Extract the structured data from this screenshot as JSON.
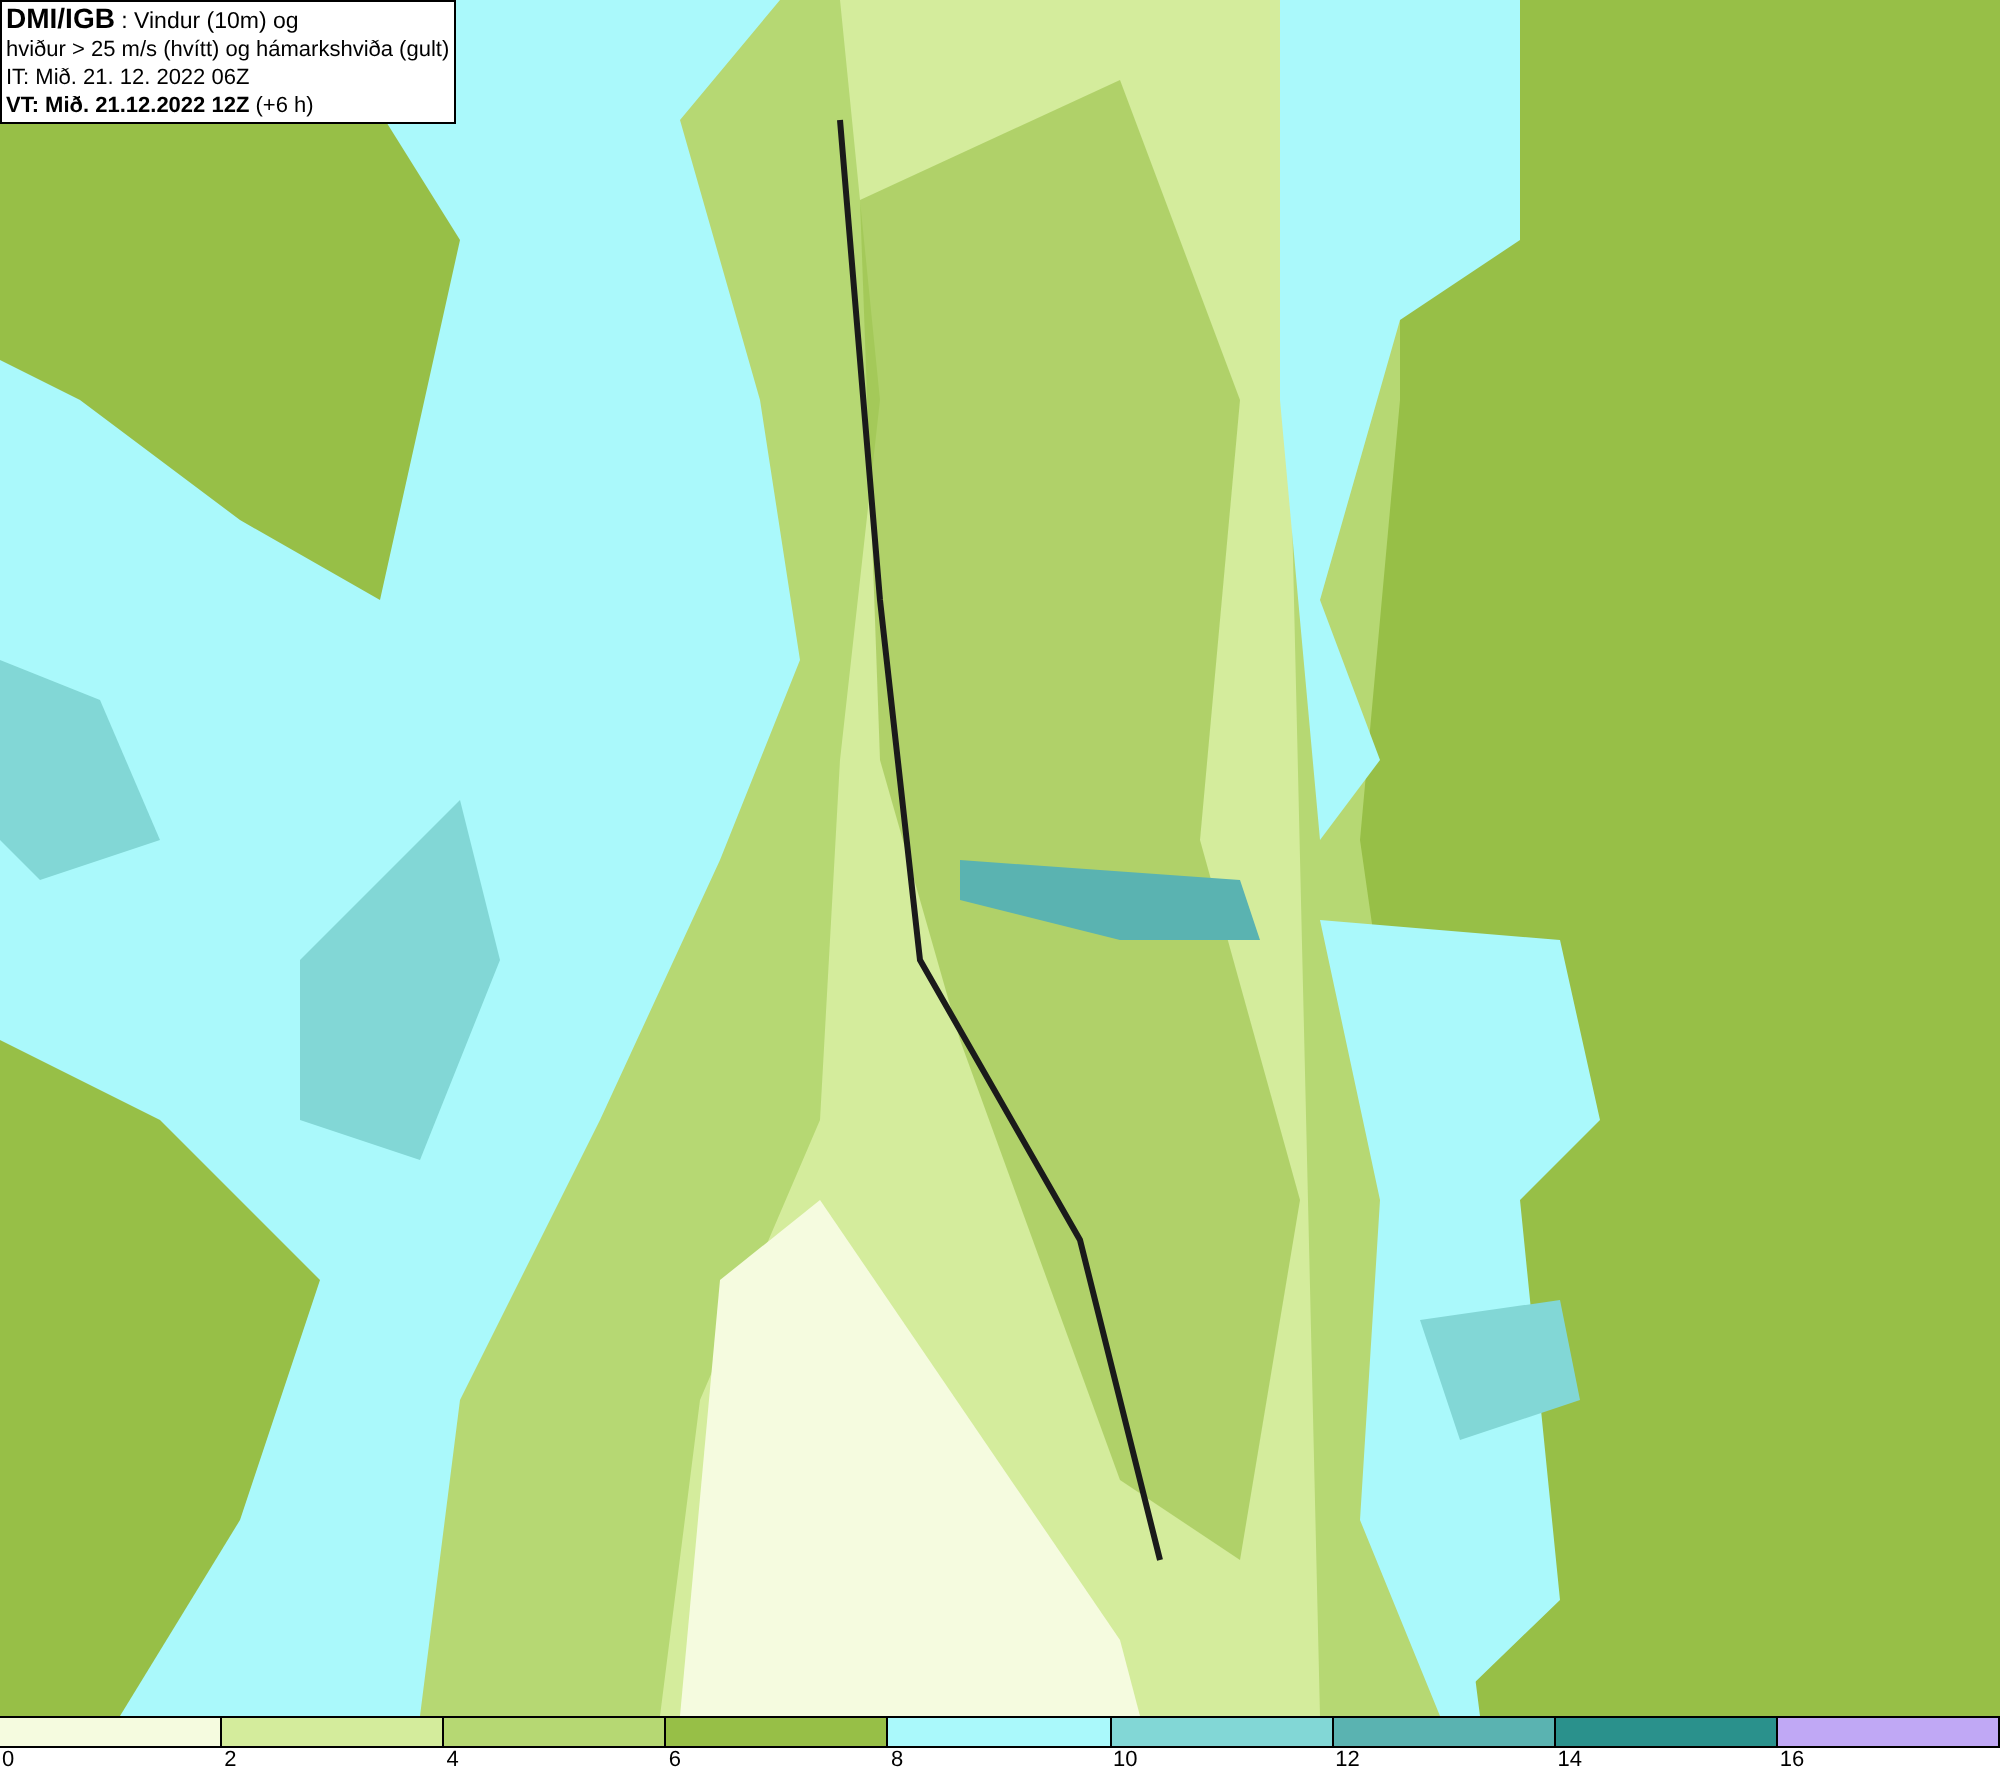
{
  "info_box": {
    "lines": [
      "**DMI/IGB** : Vindur (10m) og",
      "hviður > 25 m/s (hvítt) og hámarkshviða (gult)",
      "IT: Mið. 21. 12. 2022 06Z",
      "**VT: Mið. 21.12.2022 12Z** (+6 h)"
    ]
  },
  "legend": {
    "segments": [
      {
        "color": "#f5fbdf"
      },
      {
        "color": "#d4ec9c"
      },
      {
        "color": "#b6d873"
      },
      {
        "color": "#97bf47"
      },
      {
        "color": "#aaf9fb"
      },
      {
        "color": "#82d7d6"
      },
      {
        "color": "#5ab3b1"
      },
      {
        "color": "#2a918c"
      },
      {
        "color": "#c0a8f5"
      }
    ],
    "ticks": [
      "0",
      "2",
      "4",
      "6",
      "8",
      "10",
      "12",
      "14",
      "16"
    ]
  }
}
